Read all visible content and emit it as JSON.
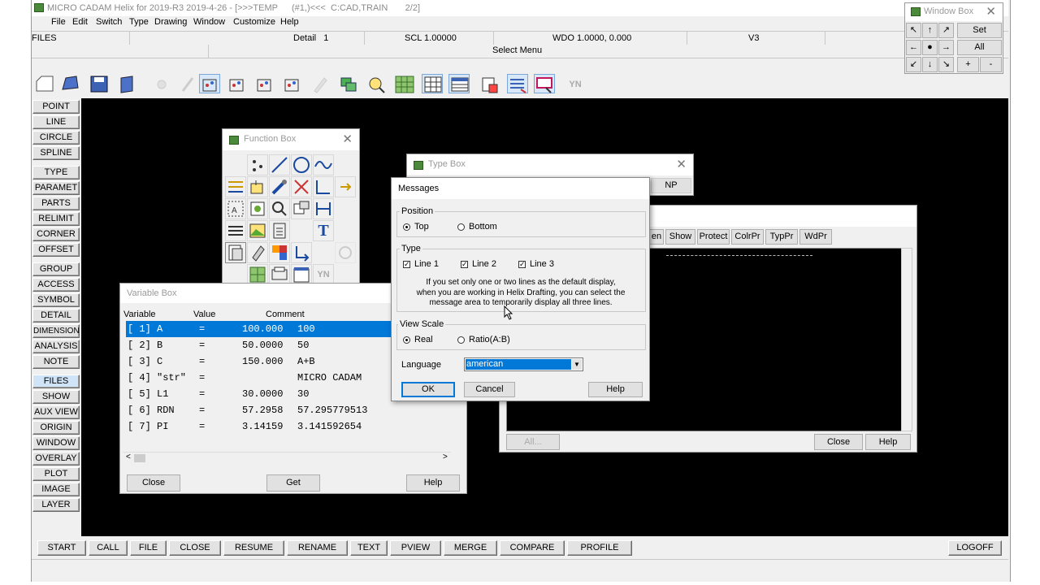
{
  "app": {
    "title": "MICRO CADAM Helix for 2019-R3 2019-4-26 - [>>>TEMP",
    "title_extra": "(#1,)<<<  C:CAD,TRAIN       2/2]",
    "menu": [
      "File",
      "Edit",
      "Switch",
      "Type",
      "Drawing",
      "Window",
      "Customize",
      "Help"
    ]
  },
  "status": {
    "mode": "FILES",
    "detail": "Detail   1",
    "scl": "SCL 1.00000",
    "wdo": "WDO 1.0000, 0.000",
    "view": "V3",
    "message": "Select Menu"
  },
  "left_menu": [
    "POINT",
    "LINE",
    "CIRCLE",
    "SPLINE",
    "TYPE",
    "PARAMET",
    "PARTS",
    "RELIMIT",
    "CORNER",
    "OFFSET",
    "GROUP",
    "ACCESS",
    "SYMBOL",
    "DETAIL",
    "DIMENSION",
    "ANALYSIS",
    "NOTE",
    "FILES",
    "SHOW",
    "AUX VIEW",
    "ORIGIN",
    "WINDOW",
    "OVERLAY",
    "PLOT",
    "IMAGE",
    "LAYER"
  ],
  "bottom_menu": [
    "START",
    "CALL",
    "FILE",
    "CLOSE",
    "RESUME",
    "RENAME",
    "TEXT",
    "PVIEW",
    "MERGE",
    "COMPARE",
    "PROFILE"
  ],
  "logoff": "LOGOFF",
  "window_box": {
    "title": "Window Box",
    "set": "Set",
    "all": "All",
    "plus": "+",
    "minus": "-"
  },
  "function_box": {
    "title": "Function Box"
  },
  "type_box": {
    "title": "Type Box",
    "np": "NP"
  },
  "variable_box": {
    "title": "Variable Box",
    "headers": [
      "Variable",
      "Value",
      "Comment"
    ],
    "rows": [
      {
        "idx": "[ 1]",
        "name": "A",
        "eq": "=",
        "value": "100.000",
        "comment": "100"
      },
      {
        "idx": "[ 2]",
        "name": "B",
        "eq": "=",
        "value": "50.0000",
        "comment": "50"
      },
      {
        "idx": "[ 3]",
        "name": "C",
        "eq": "=",
        "value": "150.000",
        "comment": "A+B"
      },
      {
        "idx": "[ 4]",
        "name": "\"str\"",
        "eq": "=",
        "value": "",
        "comment": "MICRO CADAM"
      },
      {
        "idx": "[ 5]",
        "name": "L1",
        "eq": "=",
        "value": "30.0000",
        "comment": "30"
      },
      {
        "idx": "[ 6]",
        "name": "RDN",
        "eq": "=",
        "value": "57.2958",
        "comment": "57.295779513"
      },
      {
        "idx": "[ 7]",
        "name": "PI",
        "eq": "=",
        "value": "3.14159",
        "comment": "3.141592654"
      }
    ],
    "close": "Close",
    "get": "Get",
    "help": "Help"
  },
  "attr_box": {
    "tabs": [
      "en",
      "Show",
      "Protect",
      "ColrPr",
      "TypPr",
      "WdPr"
    ],
    "all": "All...",
    "close": "Close",
    "help": "Help"
  },
  "messages": {
    "title": "Messages",
    "position_label": "Position",
    "top": "Top",
    "bottom": "Bottom",
    "type_label": "Type",
    "line1": "Line 1",
    "line2": "Line 2",
    "line3": "Line 3",
    "info1": "If you set only one or two lines as the default display,",
    "info2": "when you are working in Helix Drafting, you can select the",
    "info3": "message area to temporarily display all three lines.",
    "view_scale_label": "View Scale",
    "real": "Real",
    "ratio": "Ratio(A:B)",
    "language_label": "Language",
    "language_value": "american",
    "ok": "OK",
    "cancel": "Cancel",
    "help": "Help"
  }
}
